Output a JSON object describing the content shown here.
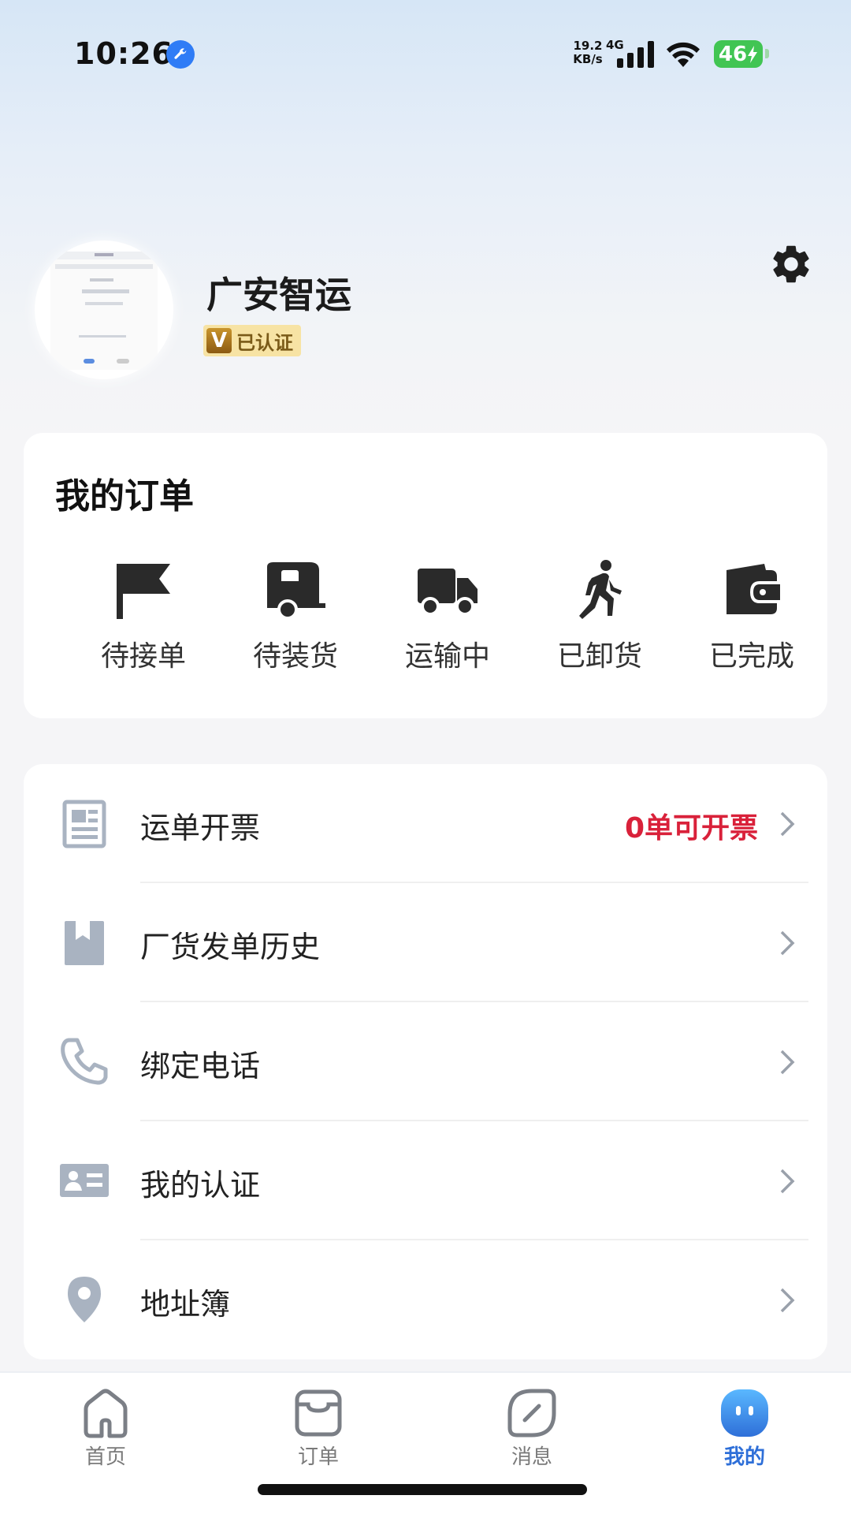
{
  "status_bar": {
    "time": "10:26",
    "net_speed_value": "19.2",
    "net_speed_unit": "KB/s",
    "network": "4G",
    "battery": "46"
  },
  "profile": {
    "name": "广安智运",
    "badge_letter": "V",
    "badge_text": "已认证"
  },
  "orders": {
    "title": "我的订单",
    "items": [
      {
        "label": "待接单",
        "icon": "flag-icon"
      },
      {
        "label": "待装货",
        "icon": "trailer-icon"
      },
      {
        "label": "运输中",
        "icon": "truck-icon"
      },
      {
        "label": "已卸货",
        "icon": "walking-person-icon"
      },
      {
        "label": "已完成",
        "icon": "wallet-icon"
      }
    ]
  },
  "menu": [
    {
      "label": "运单开票",
      "value": "0单可开票",
      "icon": "document-icon"
    },
    {
      "label": "厂货发单历史",
      "value": "",
      "icon": "bookmark-icon"
    },
    {
      "label": "绑定电话",
      "value": "",
      "icon": "phone-icon"
    },
    {
      "label": "我的认证",
      "value": "",
      "icon": "id-card-icon"
    },
    {
      "label": "地址簿",
      "value": "",
      "icon": "location-pin-icon"
    }
  ],
  "tabs": [
    {
      "label": "首页",
      "icon": "home-icon",
      "active": false
    },
    {
      "label": "订单",
      "icon": "order-icon",
      "active": false
    },
    {
      "label": "消息",
      "icon": "message-icon",
      "active": false
    },
    {
      "label": "我的",
      "icon": "mine-icon",
      "active": true
    }
  ],
  "colors": {
    "accent": "#2e6fd8",
    "invoice_count": "#d9213a",
    "badge_bg": "#f7e3a4",
    "icon_gray": "#a9b3c1"
  }
}
